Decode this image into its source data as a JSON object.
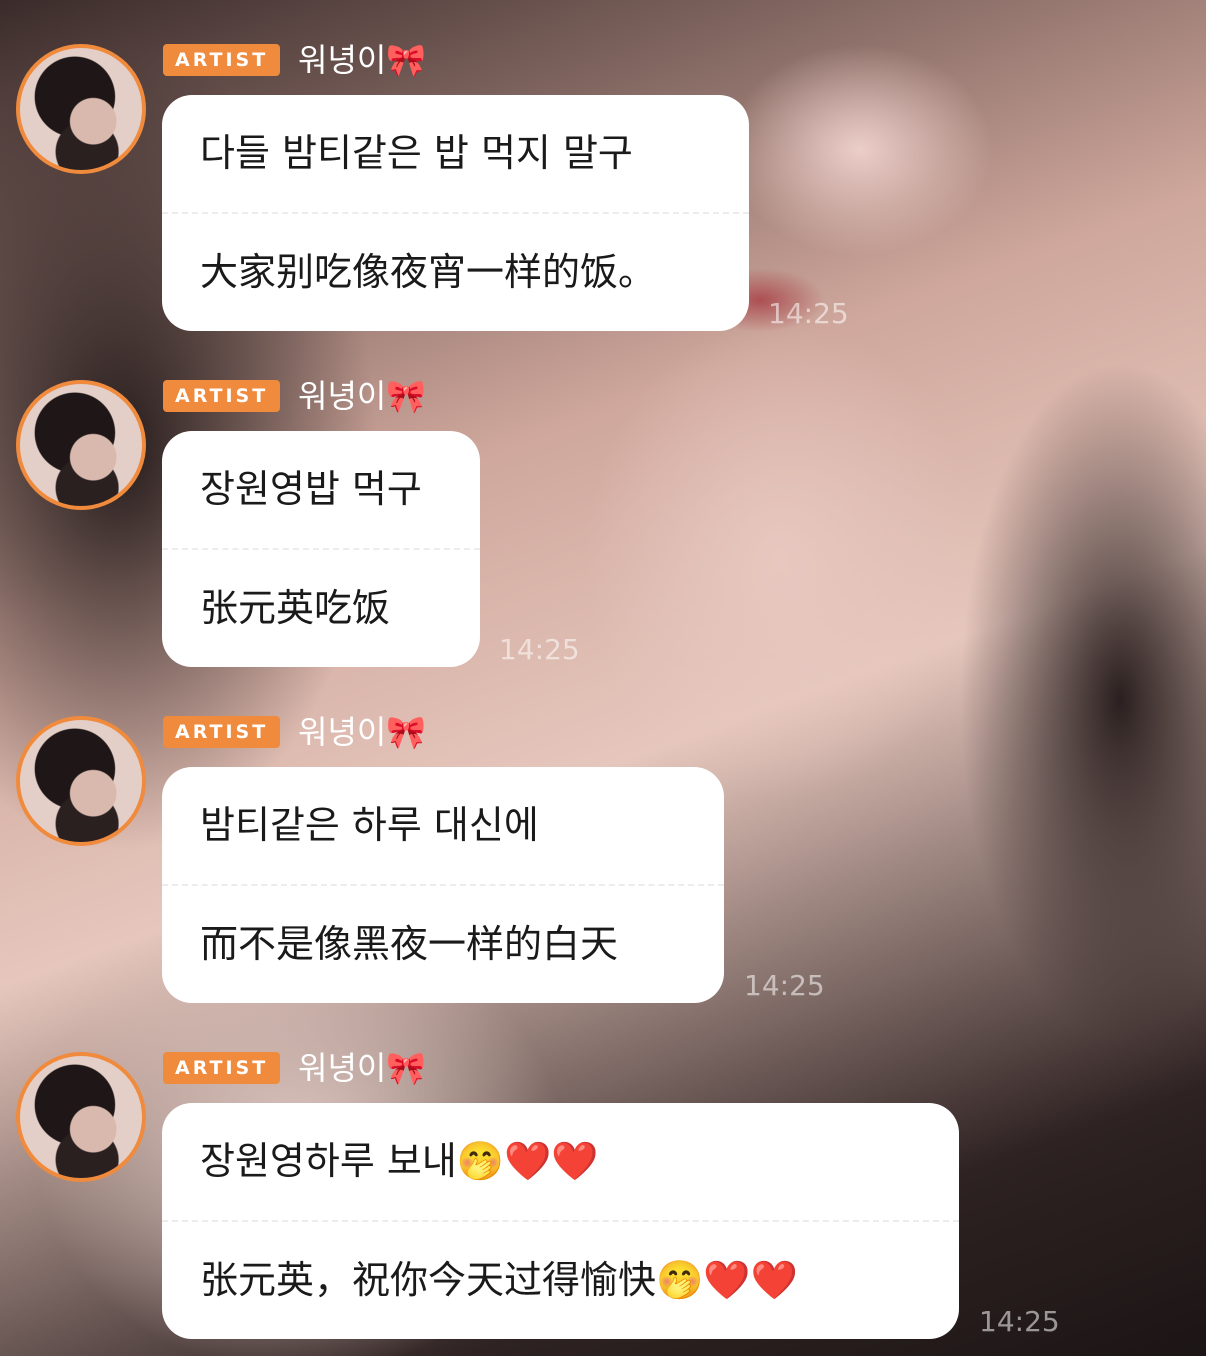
{
  "messages": [
    {
      "badge": "ARTIST",
      "username": "워녕이🎀",
      "original": "다들 밤티같은 밥 먹지 말구",
      "translation": "大家别吃像夜宵一样的饭。",
      "time": "14:25"
    },
    {
      "badge": "ARTIST",
      "username": "워녕이🎀",
      "original": "장원영밥 먹구",
      "translation": "张元英吃饭",
      "time": "14:25"
    },
    {
      "badge": "ARTIST",
      "username": "워녕이🎀",
      "original": "밤티같은 하루 대신에",
      "translation": "而不是像黑夜一样的白天",
      "time": "14:25"
    },
    {
      "badge": "ARTIST",
      "username": "워녕이🎀",
      "original": "장원영하루 보내🤭❤️❤️",
      "translation": "张元英，祝你今天过得愉快🤭❤️❤️",
      "time": "14:25"
    }
  ],
  "colors": {
    "accent": "#f08a3c",
    "bubble": "#ffffff",
    "text": "#1a1a1a"
  }
}
